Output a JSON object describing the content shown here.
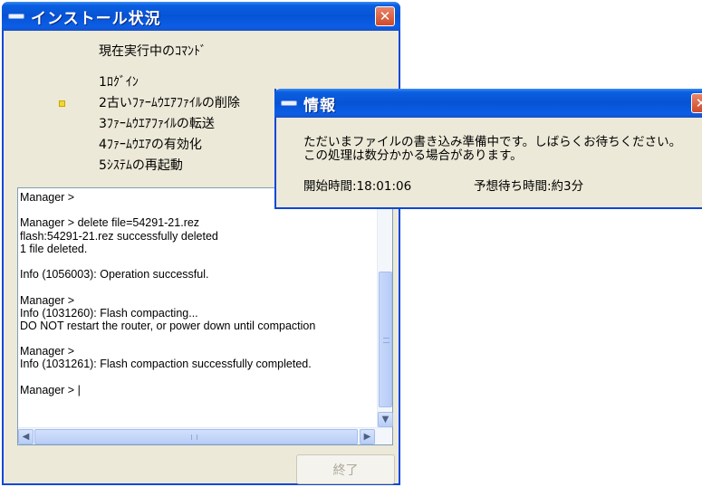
{
  "main_window": {
    "title": "インストール状況",
    "close_glyph": "✕",
    "heading": "現在実行中のｺﾏﾝﾄﾞ",
    "steps": [
      {
        "label": "1ﾛｸﾞｲﾝ",
        "current": false
      },
      {
        "label": "2古いﾌｧｰﾑｳｴｱﾌｧｲﾙの削除",
        "current": true
      },
      {
        "label": "3ﾌｧｰﾑｳｴｱﾌｧｲﾙの転送",
        "current": false
      },
      {
        "label": "4ﾌｧｰﾑｳｴｱの有効化",
        "current": false
      },
      {
        "label": "5ｼｽﾃﾑの再起動",
        "current": false
      }
    ],
    "console_lines": [
      "Manager >",
      "",
      "Manager > delete file=54291-21.rez",
      "flash:54291-21.rez successfully deleted",
      "1 file deleted.",
      "",
      "Info (1056003): Operation successful.",
      "",
      "Manager >",
      "Info (1031260): Flash compacting...",
      "DO NOT restart the router, or power down until compaction",
      "",
      "Manager >",
      "Info (1031261): Flash compaction successfully completed.",
      "",
      "Manager > |"
    ],
    "exit_button": "終了",
    "scroll_down_glyph": "▼",
    "scroll_left_glyph": "◀",
    "scroll_right_glyph": "▶"
  },
  "info_dialog": {
    "title": "情報",
    "close_glyph": "✕",
    "message_line1": "ただいまファイルの書き込み準備中です。しばらくお待ちください。",
    "message_line2": "この処理は数分かかる場合があります。",
    "start_time_label": "開始時間:18:01:06",
    "wait_time_label": "予想待ち時間:約3分"
  },
  "colors": {
    "title_bar": "#0753d6",
    "window_bg": "#ece9d8",
    "close_button": "#d9583a",
    "current_step_marker": "#f2d830"
  }
}
